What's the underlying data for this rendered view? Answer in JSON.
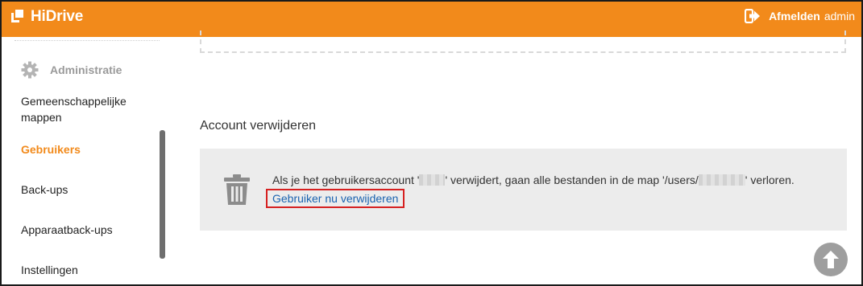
{
  "header": {
    "brand": "HiDrive",
    "logout_label": "Afmelden",
    "username": "admin"
  },
  "sidebar": {
    "admin_label": "Administratie",
    "items": [
      {
        "label": "Gemeenschappelijke",
        "label2": "mappen"
      },
      {
        "label": "Gebruikers",
        "active": true
      },
      {
        "label": "Back-ups"
      },
      {
        "label": "Apparaatback-ups"
      },
      {
        "label": "Instellingen"
      }
    ]
  },
  "main": {
    "section_title": "Account verwijderen",
    "message_part1": "Als je het gebruikersaccount '",
    "message_part2": "' verwijdert, gaan alle bestanden in de map '/users/",
    "message_part3": "' verloren.",
    "delete_link": "Gebruiker nu verwijderen"
  },
  "colors": {
    "brand_orange": "#f28a1b",
    "link_blue": "#1a63b0",
    "highlight_red": "#d62020"
  },
  "icons": [
    "hidrive-logo-icon",
    "logout-icon",
    "gear-icon",
    "trash-icon",
    "arrow-up-icon"
  ]
}
